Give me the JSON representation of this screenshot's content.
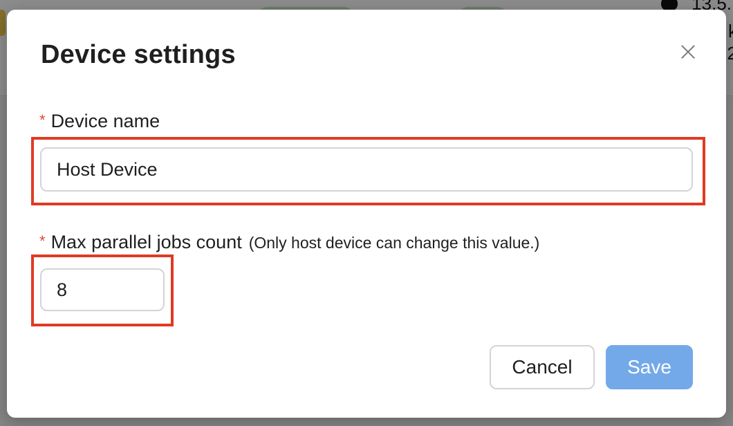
{
  "background": {
    "right_texts": [
      "13.5.",
      "k",
      "2"
    ]
  },
  "modal": {
    "title": "Device settings",
    "close_icon": "close-icon",
    "fields": {
      "device_name": {
        "required_mark": "*",
        "label": "Device name",
        "value": "Host Device"
      },
      "max_jobs": {
        "required_mark": "*",
        "label": "Max parallel jobs count",
        "hint": "(Only host device can change this value.)",
        "value": "8"
      }
    },
    "buttons": {
      "cancel": "Cancel",
      "save": "Save"
    }
  },
  "colors": {
    "required_star": "#e0483b",
    "highlight": "#e03a23",
    "save_button": "#73a9e8"
  }
}
